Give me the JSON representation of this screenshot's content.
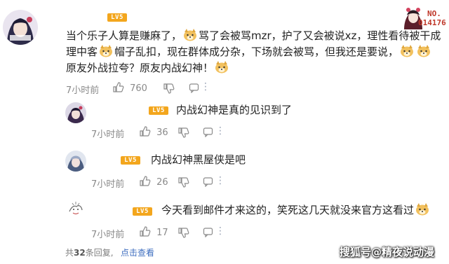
{
  "main_comment": {
    "badge": "LV5",
    "lines": [
      "当个乐子人算是赚麻了，",
      "骂了会被骂mzr，护了又会被说xz，理性看待被干成",
      "理中客",
      "帽子乱扣，现在群体成分杂，下场就会被骂，但我还是要说，",
      "原友外战拉夸？原友内战幻神！"
    ],
    "time": "7小时前",
    "likes": "760"
  },
  "stamp": {
    "no_label": "NO.",
    "no_value": "014176"
  },
  "replies": [
    {
      "badge": "LV5",
      "text": "内战幻神是真的见识到了",
      "time": "7小时前",
      "likes": "36"
    },
    {
      "badge": "LV5",
      "text": "内战幻神黑屋侠是吧",
      "time": "7小时前",
      "likes": "26"
    },
    {
      "badge": "LV5",
      "text": "今天看到邮件才来这的，笑死这几天就没来官方这看过",
      "time": "7小时前",
      "likes": "17"
    }
  ],
  "footer": {
    "total_prefix": "共",
    "total_count": "32",
    "total_suffix": "条回复,",
    "expand_label": "点击查看"
  },
  "watermark": "搜狐号@精夜说动漫",
  "icons": {
    "like": "thumbs-up-icon",
    "dislike": "thumbs-down-icon",
    "more": "more-dots-icon",
    "emoji": "doge-emoji-icon"
  },
  "colors": {
    "badge": "#f3a61d",
    "link": "#3d6dbf",
    "meta": "#8a8a8a"
  }
}
